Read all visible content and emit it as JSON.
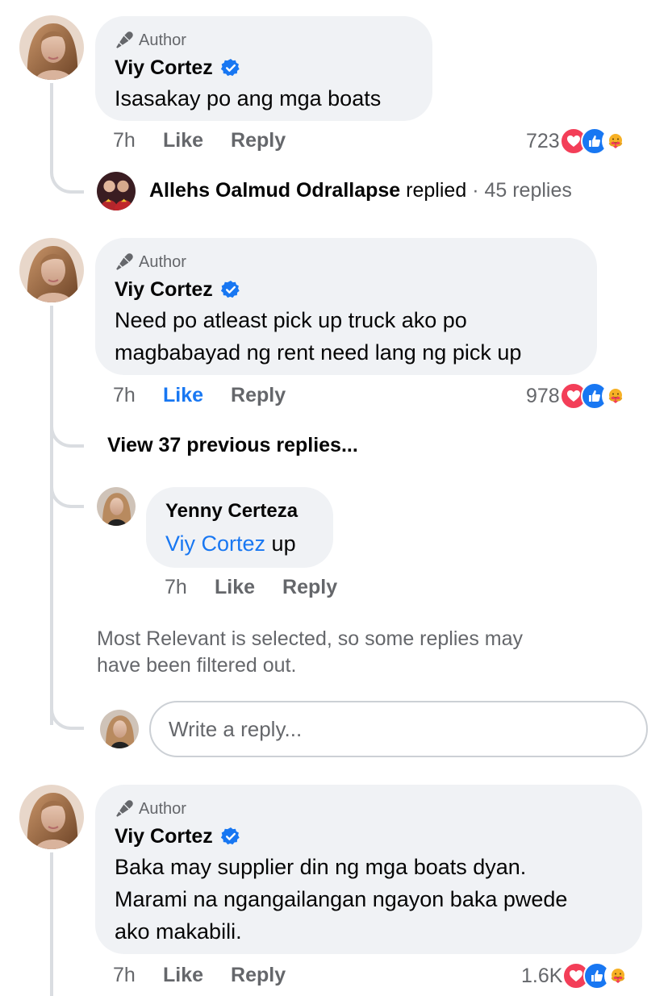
{
  "comments": [
    {
      "author_tag": "Author",
      "name": "Viy Cortez",
      "text_lines": [
        "Isasakay po ang mga boats"
      ],
      "time": "7h",
      "like": "Like",
      "reply": "Reply",
      "reaction_count": "723"
    },
    {
      "author_tag": "Author",
      "name": "Viy Cortez",
      "text_lines": [
        "Need po atleast pick up truck ako po",
        "magbabayad ng rent need lang ng pick up"
      ],
      "time": "7h",
      "like": "Like",
      "reply": "Reply",
      "reaction_count": "978"
    },
    {
      "author_tag": "Author",
      "name": "Viy Cortez",
      "text_lines": [
        "Baka may supplier din ng mga boats dyan.",
        "Marami na ngangailangan ngayon baka pwede",
        "ako makabili."
      ],
      "time": "7h",
      "like": "Like",
      "reply": "Reply",
      "reaction_count": "1.6K"
    }
  ],
  "reply_summary": {
    "name": "Allehs Oalmud Odrallapse",
    "verb": "replied",
    "separator": "·",
    "count_text": "45 replies"
  },
  "view_previous": "View 37 previous replies...",
  "reply": {
    "name": "Yenny Certeza",
    "mention": "Viy Cortez",
    "text": " up",
    "time": "7h",
    "like": "Like",
    "reply": "Reply"
  },
  "filter_notice_lines": [
    "Most Relevant is selected, so some replies may",
    "have been filtered out."
  ],
  "reply_input": {
    "placeholder": "Write a reply..."
  },
  "colors": {
    "bubble": "#f0f2f5",
    "like_blue": "#1877f2",
    "love_red": "#f33e58",
    "care_yellow": "#f7b125",
    "secondary_text": "#65676b",
    "thread_line": "#dadde1"
  },
  "icons": {
    "author": "microphone-icon",
    "verified": "verified-badge-icon",
    "reactions": [
      "love-reaction-icon",
      "like-reaction-icon",
      "care-reaction-icon"
    ]
  }
}
